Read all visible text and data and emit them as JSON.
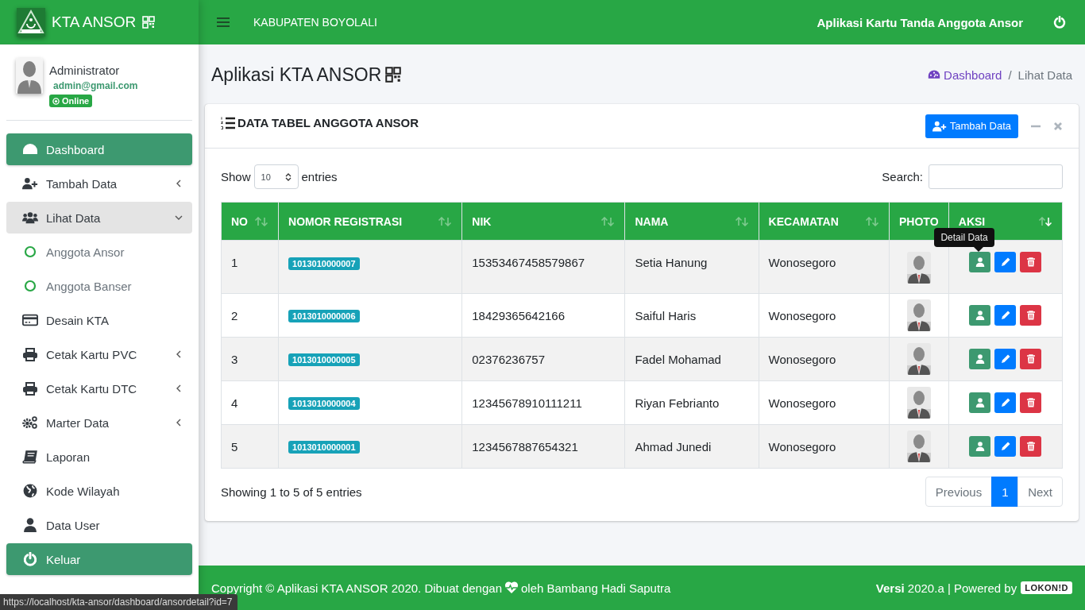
{
  "brand": {
    "title": "KTA ANSOR"
  },
  "user": {
    "name": "Administrator",
    "email": "admin@gmail.com",
    "status": "Online"
  },
  "sidebar": {
    "items": [
      {
        "kind": "item",
        "label": "Dashboard",
        "selected": true
      },
      {
        "kind": "item",
        "label": "Tambah Data",
        "selected": false,
        "expanded": false
      },
      {
        "kind": "item",
        "label": "Lihat Data",
        "selected": false,
        "expanded": true,
        "children": [
          {
            "label": "Anggota Ansor",
            "selected": false
          },
          {
            "label": "Anggota Banser",
            "selected": false
          }
        ]
      },
      {
        "kind": "item",
        "label": "Desain KTA",
        "selected": false
      },
      {
        "kind": "item",
        "label": "Cetak Kartu PVC",
        "selected": false,
        "expanded": false
      },
      {
        "kind": "item",
        "label": "Cetak Kartu DTC",
        "selected": false,
        "expanded": false
      },
      {
        "kind": "item",
        "label": "Marter Data",
        "selected": false,
        "expanded": false
      },
      {
        "kind": "item",
        "label": "Laporan",
        "selected": false
      },
      {
        "kind": "item",
        "label": "Kode Wilayah",
        "selected": false
      },
      {
        "kind": "item",
        "label": "Data User",
        "selected": false
      },
      {
        "kind": "logout",
        "label": "Keluar"
      }
    ]
  },
  "topbar": {
    "region": "KABUPATEN BOYOLALI",
    "app_name": "Aplikasi Kartu Tanda Anggota Ansor"
  },
  "page": {
    "title": "Aplikasi KTA ANSOR",
    "breadcrumb": [
      {
        "label": "Dashboard",
        "kind": "link"
      },
      {
        "label": "Lihat Data",
        "kind": "current"
      }
    ],
    "separator": "/"
  },
  "card": {
    "title": "DATA TABEL ANGGOTA ANSOR",
    "add_button": "Tambah Data",
    "show_label": "Show",
    "length_value": "10",
    "entries_label": "entries",
    "search_label": "Search:",
    "columns": [
      {
        "label": "NO",
        "sortable": true,
        "sorted": false
      },
      {
        "label": "NOMOR REGISTRASI",
        "sortable": true,
        "sorted": false
      },
      {
        "label": "NIK",
        "sortable": true,
        "sorted": false
      },
      {
        "label": "NAMA",
        "sortable": true,
        "sorted": false
      },
      {
        "label": "KECAMATAN",
        "sortable": true,
        "sorted": false
      },
      {
        "label": "PHOTO",
        "sortable": false
      },
      {
        "label": "AKSI",
        "sortable": true,
        "sorted": true
      }
    ],
    "rows": [
      {
        "no": "1",
        "registration": "1013010000007",
        "nik": "15353467458579867",
        "name": "Setia Hanung",
        "district": "Wonosegoro",
        "tooltip": "Detail Data"
      },
      {
        "no": "2",
        "registration": "1013010000006",
        "nik": "18429365642166",
        "name": "Saiful Haris",
        "district": "Wonosegoro"
      },
      {
        "no": "3",
        "registration": "1013010000005",
        "nik": "02376236757",
        "name": "Fadel Mohamad",
        "district": "Wonosegoro"
      },
      {
        "no": "4",
        "registration": "1013010000004",
        "nik": "12345678910111211",
        "name": "Riyan Febrianto",
        "district": "Wonosegoro"
      },
      {
        "no": "5",
        "registration": "1013010000001",
        "nik": "1234567887654321",
        "name": "Ahmad Junedi",
        "district": "Wonosegoro"
      }
    ],
    "info": "Showing 1 to 5 of 5 entries",
    "pagination": [
      {
        "label": "Previous",
        "selected": false,
        "disabled": true
      },
      {
        "label": "1",
        "selected": true,
        "disabled": false
      },
      {
        "label": "Next",
        "selected": false,
        "disabled": true
      }
    ]
  },
  "footer": {
    "copyright_before": "Copyright © Aplikasi KTA ANSOR 2020. Dibuat dengan",
    "copyright_after": "oleh Bambang Hadi Saputra",
    "version": "**Versi** 2020.a | Powered by",
    "powered_badge": "LOKON!D"
  },
  "status_bar": {
    "url": "https://localhost/kta-ansor/dashboard/ansordetail?id=7"
  }
}
